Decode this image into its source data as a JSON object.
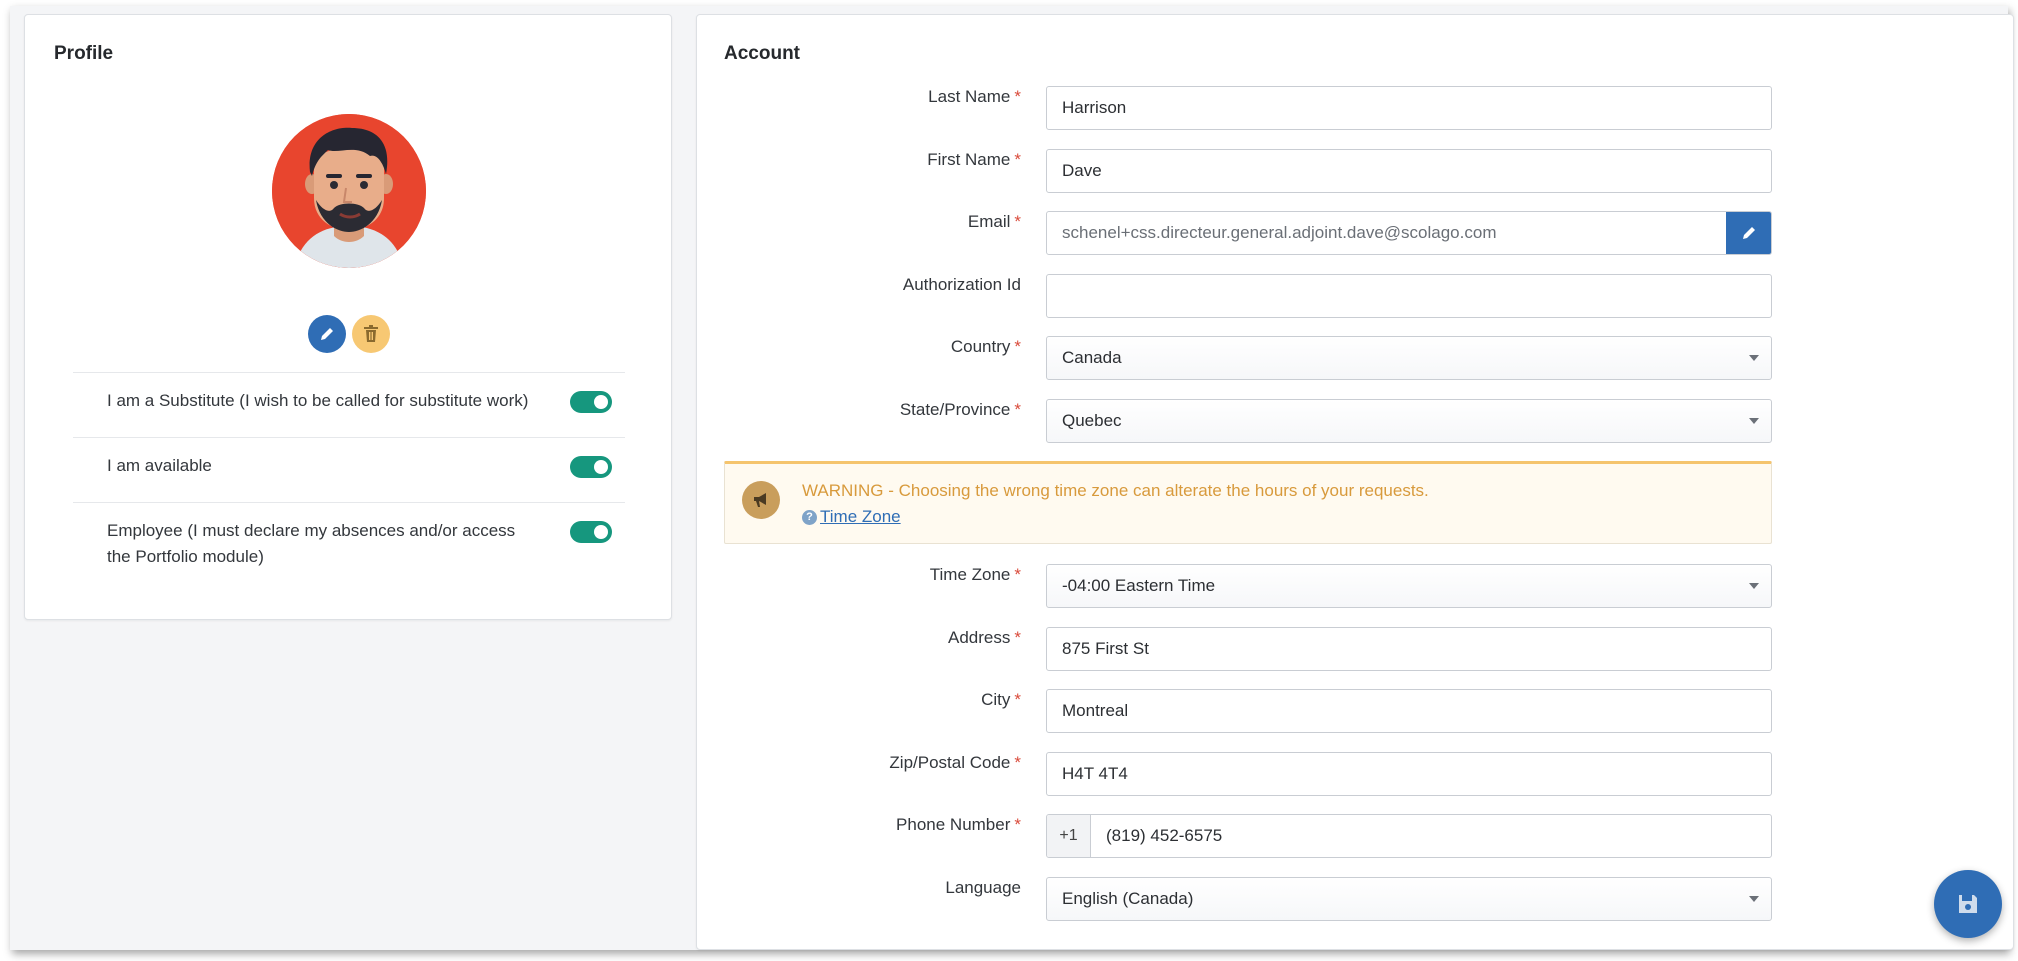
{
  "profile": {
    "title": "Profile",
    "toggles": [
      {
        "label": "I am a Substitute (I wish to be called for substitute work)",
        "on": true
      },
      {
        "label": "I am available",
        "on": true
      },
      {
        "label": "Employee (I must declare my absences and/or access the Portfolio module)",
        "on": true
      }
    ]
  },
  "account": {
    "title": "Account",
    "required_mark": "*",
    "fields": {
      "last_name": {
        "label": "Last Name",
        "value": "Harrison"
      },
      "first_name": {
        "label": "First Name",
        "value": "Dave"
      },
      "email": {
        "label": "Email",
        "value": "schenel+css.directeur.general.adjoint.dave@scolago.com"
      },
      "authorization_id": {
        "label": "Authorization Id",
        "value": ""
      },
      "country": {
        "label": "Country",
        "value": "Canada"
      },
      "state": {
        "label": "State/Province",
        "value": "Quebec"
      },
      "time_zone": {
        "label": "Time Zone",
        "value": "-04:00 Eastern Time"
      },
      "address": {
        "label": "Address",
        "value": "875 First St"
      },
      "city": {
        "label": "City",
        "value": "Montreal"
      },
      "zip": {
        "label": "Zip/Postal Code",
        "value": "H4T 4T4"
      },
      "phone": {
        "label": "Phone Number",
        "prefix": "+1",
        "value": "(819) 452-6575"
      },
      "language": {
        "label": "Language",
        "value": "English (Canada)"
      }
    },
    "warning": {
      "text": "WARNING - Choosing the wrong time zone can alterate the hours of your requests.",
      "help_icon": "?",
      "link": "Time Zone"
    }
  },
  "colors": {
    "primary": "#2f6db5",
    "toggle_on": "#16977e",
    "warning_text": "#d89a3c",
    "delete": "#f7c873"
  },
  "icons": {
    "edit": "pencil-icon",
    "delete": "trash-icon",
    "warning": "megaphone-icon",
    "save": "floppy-disk-icon"
  }
}
